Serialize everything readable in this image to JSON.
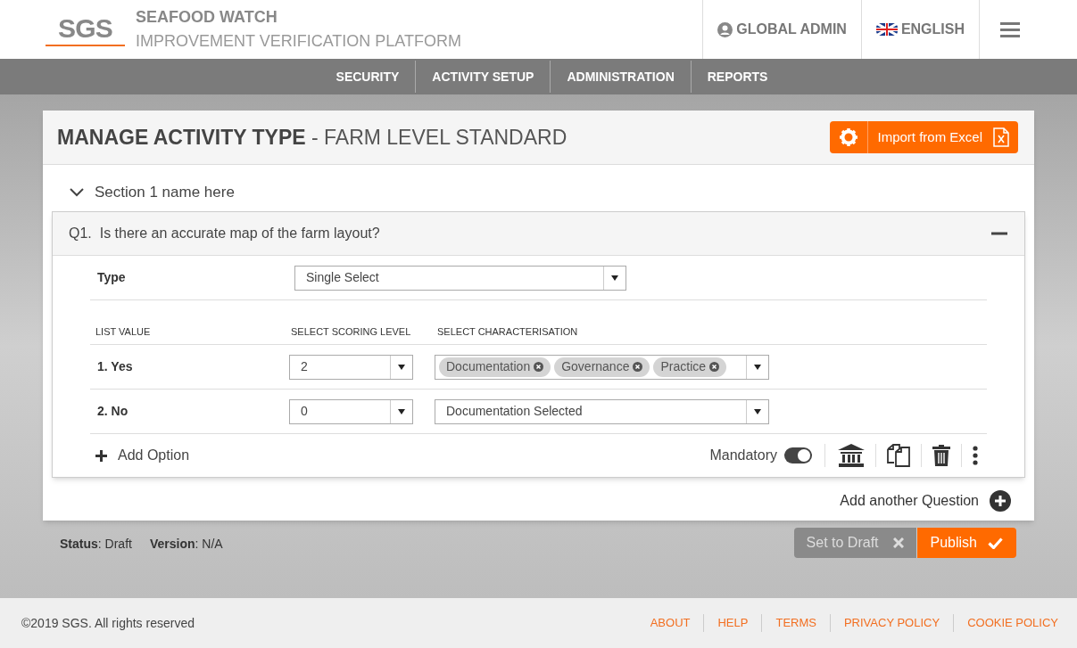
{
  "header": {
    "logo": "SGS",
    "title": "SEAFOOD WATCH",
    "subtitle": "IMPROVEMENT VERIFICATION PLATFORM",
    "user": "GLOBAL ADMIN",
    "language": "ENGLISH"
  },
  "nav": [
    "SECURITY",
    "ACTIVITY SETUP",
    "ADMINISTRATION",
    "REPORTS"
  ],
  "page": {
    "title": "MANAGE ACTIVITY TYPE",
    "subtitle": "- FARM LEVEL STANDARD",
    "import_button": "Import from Excel"
  },
  "section": {
    "title": "Section 1 name here",
    "expanded": true
  },
  "question": {
    "title": "Q1.  Is there an accurate map of the farm layout?",
    "expanded": true,
    "type_label": "Type",
    "type_value": "Single Select",
    "columns": [
      "LIST VALUE",
      "SELECT SCORING LEVEL",
      "SELECT CHARACTERISATION"
    ],
    "options": [
      {
        "label": "1. Yes",
        "score": "2",
        "kind": "tags",
        "tags": [
          "Documentation",
          "Governance",
          "Practice"
        ]
      },
      {
        "label": "2. No",
        "score": "0",
        "kind": "text",
        "value": "Documentation Selected"
      }
    ],
    "add_option": "Add Option",
    "mandatory_label": "Mandatory",
    "mandatory": true
  },
  "add_question": "Add another Question",
  "status": "**Status**: Draft",
  "version": "**Version**: N/A",
  "actions": {
    "draft": {
      "label": "Set to Draft",
      "disabled": true
    },
    "publish": {
      "label": "Publish",
      "disabled": false
    }
  },
  "footer": {
    "copyright": "©2019 SGS. All rights reserved",
    "links": [
      "ABOUT",
      "HELP",
      "TERMS",
      "PRIVACY POLICY",
      "COOKIE POLICY"
    ]
  }
}
